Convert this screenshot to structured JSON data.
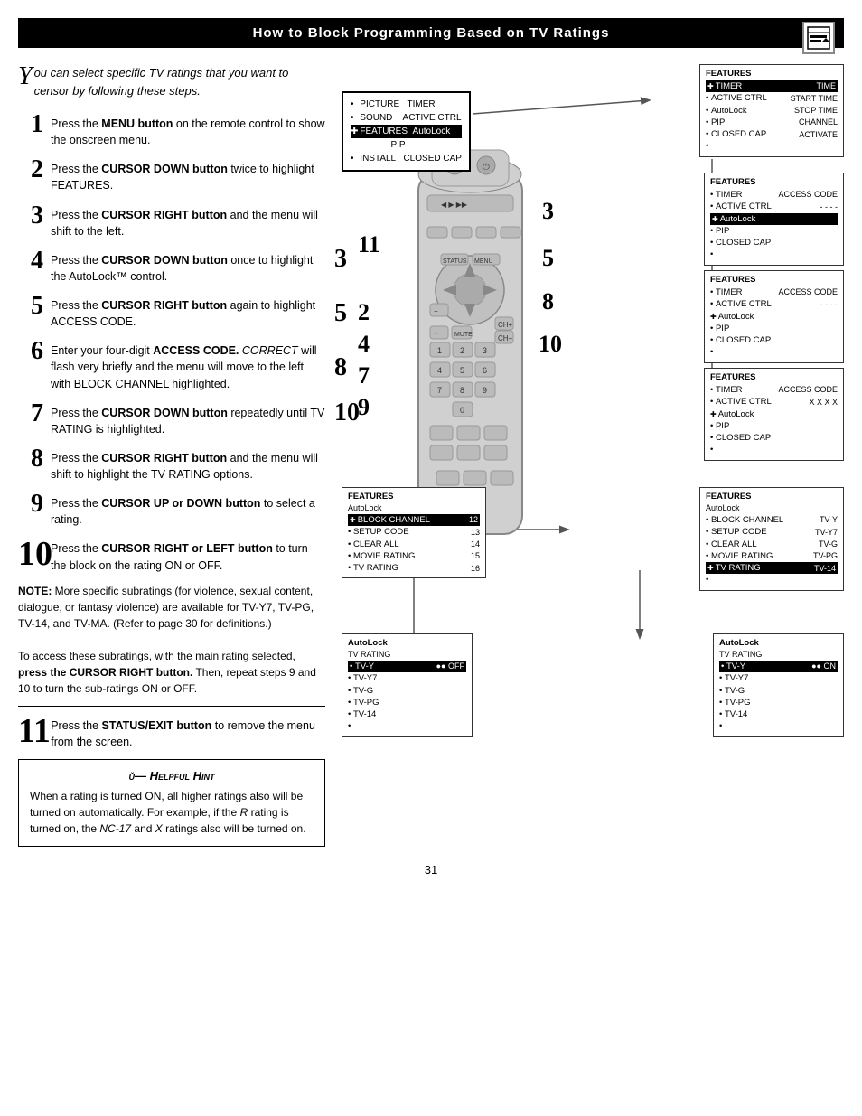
{
  "header": {
    "title": "How to Block Programming Based on TV Ratings"
  },
  "intro": {
    "drop_cap": "Y",
    "text": "ou can select specific TV ratings that you want to censor by following these steps."
  },
  "steps": [
    {
      "num": "1",
      "text": "Press the <b>MENU button</b> on the remote control to show the onscreen menu."
    },
    {
      "num": "2",
      "text": "Press the <b>CURSOR DOWN button</b> twice to highlight FEATURES."
    },
    {
      "num": "3",
      "text": "Press the <b>CURSOR RIGHT button</b> and the menu will shift to the left."
    },
    {
      "num": "4",
      "text": "Press the <b>CURSOR DOWN button</b> once to highlight the AutoLock™ control."
    },
    {
      "num": "5",
      "text": "Press the <b>CURSOR RIGHT button</b> again to highlight ACCESS CODE."
    },
    {
      "num": "6",
      "text": "Enter your four-digit <b>ACCESS CODE.</b> <i>CORRECT</i> will flash very briefly and the menu will move to the left with BLOCK CHANNEL highlighted."
    },
    {
      "num": "7",
      "text": "Press the <b>CURSOR DOWN button</b> repeatedly until TV RATING is highlighted."
    },
    {
      "num": "8",
      "text": "Press the <b>CURSOR RIGHT button</b> and the menu will shift to highlight the TV RATING options."
    },
    {
      "num": "9",
      "text": "Press the <b>CURSOR UP or DOWN button</b> to select a rating."
    },
    {
      "num": "10",
      "text": "Press the <b>CURSOR RIGHT or LEFT button</b> to turn the block on the rating ON or OFF."
    }
  ],
  "note": {
    "text": "<b>NOTE:</b> More specific subratings (for violence, sexual content, dialogue, or fantasy violence) are available for TV-Y7, TV-PG, TV-14, and TV-MA. (Refer to page 30 for definitions.)\n\nTo access these subratings, with the main rating selected, <b>press the CURSOR RIGHT button.</b> Then, repeat steps 9 and 10 to turn the sub-ratings ON or OFF."
  },
  "step11": {
    "num": "11",
    "text": "Press the <b>STATUS/EXIT button</b> to remove the menu from the screen."
  },
  "hint": {
    "title": "Helpful Hint",
    "text": "When a rating is turned ON, all higher ratings also will be turned on automatically.  For example, if the <i>R</i> rating is turned on, the <i>NC-17</i> and <i>X</i> ratings also will be turned on."
  },
  "page_num": "31",
  "diagram": {
    "menus": {
      "top_left_main": {
        "rows": [
          {
            "bullet": "•",
            "label": "PICTURE",
            "right": "TIMER"
          },
          {
            "bullet": "•",
            "label": "SOUND",
            "right": "ACTIVE CTRL"
          },
          {
            "bullet": "",
            "label": "✚FEATURES",
            "right": "AutoLock",
            "hl": true
          },
          {
            "bullet": "",
            "label": "",
            "right": "PIP"
          },
          {
            "bullet": "•",
            "label": "INSTALL",
            "right": "CLOSED CAP"
          }
        ]
      },
      "top_right_1": {
        "title": "FEATURES",
        "rows": [
          {
            "arr": "✚",
            "label": "TIMER",
            "right": "TIME",
            "hl": true
          },
          {
            "bullet": "•",
            "label": "ACTIVE CTRL",
            "right": "START TIME"
          },
          {
            "bullet": "•",
            "label": "AutoLock",
            "right": "STOP TIME"
          },
          {
            "bullet": "•",
            "label": "PIP",
            "right": "CHANNEL"
          },
          {
            "bullet": "•",
            "label": "CLOSED CAP",
            "right": "ACTIVATE"
          },
          {
            "bullet": "•",
            "label": ""
          }
        ]
      },
      "right_2": {
        "title": "FEATURES",
        "rows": [
          {
            "bullet": "•",
            "label": "TIMER",
            "right": "ACCESS CODE"
          },
          {
            "bullet": "•",
            "label": "ACTIVE CTRL",
            "right": "- - - -"
          },
          {
            "bullet": "",
            "label": "✚AutoLock",
            "hl": true
          },
          {
            "bullet": "•",
            "label": "PIP"
          },
          {
            "bullet": "•",
            "label": "CLOSED CAP"
          },
          {
            "bullet": "•",
            "label": ""
          }
        ]
      },
      "right_3": {
        "title": "FEATURES",
        "rows": [
          {
            "bullet": "•",
            "label": "TIMER",
            "right": "ACCESS CODE"
          },
          {
            "bullet": "•",
            "label": "ACTIVE CTRL",
            "right": "- - - -"
          },
          {
            "bullet": "",
            "label": "✚AutoLock"
          },
          {
            "bullet": "•",
            "label": "PIP"
          },
          {
            "bullet": "•",
            "label": "CLOSED CAP"
          },
          {
            "bullet": "•",
            "label": ""
          }
        ]
      },
      "right_4": {
        "title": "FEATURES",
        "rows": [
          {
            "bullet": "•",
            "label": "TIMER",
            "right": "ACCESS CODE"
          },
          {
            "bullet": "•",
            "label": "ACTIVE CTRL",
            "right": "X X X X"
          },
          {
            "bullet": "",
            "label": "✚AutoLock"
          },
          {
            "bullet": "•",
            "label": "PIP"
          },
          {
            "bullet": "•",
            "label": "CLOSED CAP"
          },
          {
            "bullet": "•",
            "label": ""
          }
        ]
      },
      "bottom_left_1": {
        "title": "FEATURES",
        "subtitle": "AutoLock",
        "rows": [
          {
            "arr": "✚",
            "label": "BLOCK CHANNEL",
            "right": "12",
            "hl": true
          },
          {
            "bullet": "•",
            "label": "SETUP CODE",
            "right": "13"
          },
          {
            "bullet": "•",
            "label": "CLEAR ALL",
            "right": "14"
          },
          {
            "bullet": "•",
            "label": "MOVIE RATING",
            "right": "15"
          },
          {
            "bullet": "•",
            "label": "TV RATING",
            "right": "16"
          }
        ]
      },
      "bottom_right_1": {
        "title": "FEATURES",
        "subtitle": "AutoLock",
        "rows": [
          {
            "bullet": "•",
            "label": "BLOCK CHANNEL",
            "right": "TV-Y"
          },
          {
            "bullet": "•",
            "label": "SETUP CODE",
            "right": "TV-Y7"
          },
          {
            "bullet": "•",
            "label": "CLEAR ALL",
            "right": "TV-G"
          },
          {
            "bullet": "•",
            "label": "MOVIE RATING",
            "right": "TV-PG"
          },
          {
            "bullet": "",
            "label": "✚TV RATING",
            "right": "TV-14",
            "hl": true
          },
          {
            "bullet": "•",
            "label": ""
          }
        ]
      },
      "bottom_left_2": {
        "title": "AutoLock",
        "subtitle": "TV RATING",
        "rows": [
          {
            "arr": "•",
            "label": "TV-Y",
            "right": "OFF",
            "hl": true
          },
          {
            "bullet": "•",
            "label": "TV-Y7"
          },
          {
            "bullet": "•",
            "label": "TV-G"
          },
          {
            "bullet": "•",
            "label": "TV-PG"
          },
          {
            "bullet": "•",
            "label": "TV-14"
          },
          {
            "bullet": "•",
            "label": ""
          }
        ]
      },
      "bottom_right_2": {
        "title": "AutoLock",
        "subtitle": "TV RATING",
        "rows": [
          {
            "arr": "•",
            "label": "TV-Y",
            "right": "ON",
            "hl": true
          },
          {
            "bullet": "•",
            "label": "TV-Y7"
          },
          {
            "bullet": "•",
            "label": "TV-G"
          },
          {
            "bullet": "•",
            "label": "TV-PG"
          },
          {
            "bullet": "•",
            "label": "TV-14"
          },
          {
            "bullet": "•",
            "label": ""
          }
        ]
      }
    }
  }
}
